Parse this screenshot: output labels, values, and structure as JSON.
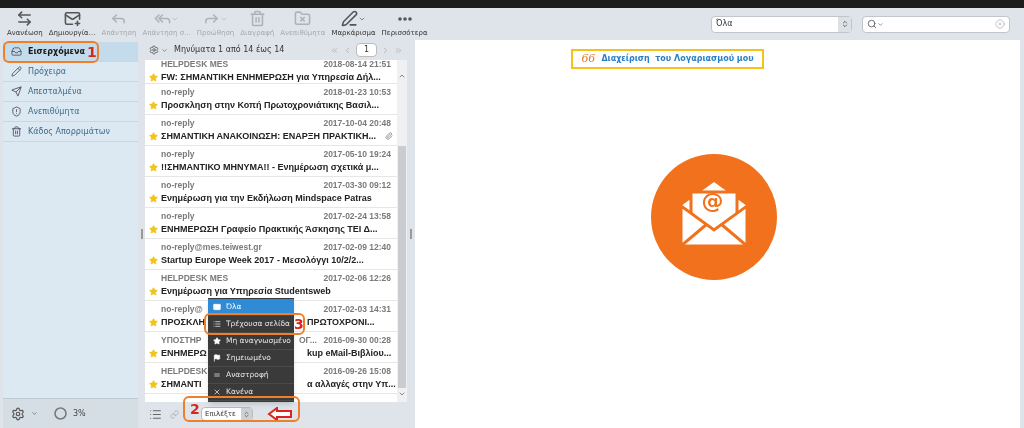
{
  "toolbar": {
    "buttons": [
      {
        "label": "Ανανέωση",
        "kind": "refresh",
        "disabled": false,
        "caret": false
      },
      {
        "label": "Δημιουργία...",
        "kind": "compose",
        "disabled": false,
        "caret": false
      },
      {
        "label": "Απάντηση",
        "kind": "reply",
        "disabled": true,
        "caret": false
      },
      {
        "label": "Απάντηση σ...",
        "kind": "replyall",
        "disabled": true,
        "caret": true
      },
      {
        "label": "Προώθηση",
        "kind": "forward",
        "disabled": true,
        "caret": true
      },
      {
        "label": "Διαγραφή",
        "kind": "delete",
        "disabled": true,
        "caret": false
      },
      {
        "label": "Ανεπιθύμητα",
        "kind": "spam",
        "disabled": true,
        "caret": false
      },
      {
        "label": "Μαρκάρισμα",
        "kind": "mark",
        "disabled": false,
        "caret": true
      },
      {
        "label": "Περισσότερα",
        "kind": "more",
        "disabled": false,
        "caret": false
      }
    ],
    "filter": {
      "value": "Όλα"
    }
  },
  "folders": [
    {
      "label": "Εισερχόμενα",
      "kind": "inbox",
      "selected": true
    },
    {
      "label": "Πρόχειρα",
      "kind": "drafts",
      "selected": false
    },
    {
      "label": "Απεσταλμένα",
      "kind": "sent",
      "selected": false
    },
    {
      "label": "Ανεπιθύμητα",
      "kind": "junk",
      "selected": false
    },
    {
      "label": "Κάδος Απορριμάτων",
      "kind": "trash",
      "selected": false
    }
  ],
  "quota": {
    "text": "3%"
  },
  "message_list": {
    "summary": "Μηνύματα 1 από 14 έως 14",
    "page": "1",
    "messages": [
      {
        "sender": "HELPDESK MES",
        "date": "2018-08-14 21:51",
        "subject": "FW: ΣΗΜΑΝΤΙΚΗ ΕΝΗΜΕΡΩΣΗ για Υπηρεσία Δήλ...",
        "flagged": true,
        "attachment": false
      },
      {
        "sender": "no-reply",
        "date": "2018-01-23 10:53",
        "subject": "Προσκληση στην Κοπή Πρωτοχρονιάτικης Βασιλ...",
        "flagged": true,
        "attachment": false
      },
      {
        "sender": "no-reply",
        "date": "2017-10-04 20:48",
        "subject": "ΣΗΜΑΝΤΙΚΗ ΑΝΑΚΟΙΝΩΣΗ: ΕΝΑΡΞΗ ΠΡΑΚΤΙΚΗ...",
        "flagged": true,
        "attachment": true
      },
      {
        "sender": "no-reply",
        "date": "2017-05-10 19:24",
        "subject": "!!ΣΗΜΑΝΤΙΚΟ ΜΗΝΥΜΑ!! - Ενημέρωση σχετικά μ...",
        "flagged": true,
        "attachment": false
      },
      {
        "sender": "no-reply",
        "date": "2017-03-30 09:12",
        "subject": "Ενημέρωση για την Εκδήλωση Mindspace Patras",
        "flagged": true,
        "attachment": false
      },
      {
        "sender": "no-reply",
        "date": "2017-02-24 13:58",
        "subject": "ΕΝΗΜΕΡΩΣΗ Γραφείο Πρακτικής Άσκησης ΤΕΙ Δ...",
        "flagged": true,
        "attachment": false
      },
      {
        "sender": "no-reply@mes.teiwest.gr",
        "date": "2017-02-09 12:40",
        "subject": "Startup Europe Week 2017 - Μεσολόγγι 10/2/2...",
        "flagged": true,
        "attachment": false
      },
      {
        "sender": "HELPDESK MES",
        "date": "2017-02-06 12:26",
        "subject": "Ενημέρωση για Υπηρεσία Studentsweb",
        "flagged": true,
        "attachment": false
      },
      {
        "sender": "no-reply@",
        "date": "2017-02-03 14:31",
        "subject": "ΠΡΟΣΚΛΗ",
        "subject_tail": "ΠΡΩΤΟΧΡΟΝΙ...",
        "flagged": true,
        "attachment": false
      },
      {
        "sender": "ΥΠΟΣΤΗΡ",
        "sender_tail": "ΟΓ...",
        "date": "2016-09-30 00:28",
        "subject": "ΕΝΗΜΕΡΩ",
        "subject_tail": "kup eMail-Βιβλίου...",
        "flagged": true,
        "attachment": false
      },
      {
        "sender": "HELPDESK",
        "date": "2016-09-26 15:08",
        "subject": "ΣΗΜΑΝΤΙ",
        "subject_tail": "α αλλαγές στην Υπ...",
        "flagged": true,
        "attachment": false
      }
    ],
    "select": {
      "value": "Επιλέξτε"
    }
  },
  "select_menu": {
    "items": [
      {
        "label": "Όλα",
        "kind": "envelope",
        "selected": true
      },
      {
        "label": "Τρέχουσα σελίδα",
        "kind": "list",
        "selected": false
      },
      {
        "label": "Μη αναγνωσμένο",
        "kind": "star",
        "selected": false
      },
      {
        "label": "Σημειωμένο",
        "kind": "flag",
        "selected": false
      },
      {
        "label": "Αναστροφή",
        "kind": "invert",
        "selected": false
      },
      {
        "label": "Κανένα",
        "kind": "none",
        "selected": false
      }
    ]
  },
  "annotations": [
    {
      "number": "1"
    },
    {
      "number": "2"
    },
    {
      "number": "3"
    }
  ],
  "preview": {
    "account_link": {
      "mark": "66",
      "label": "Διαχείριση  του Λογαριασμού μου"
    },
    "logo_mark": "@"
  }
}
